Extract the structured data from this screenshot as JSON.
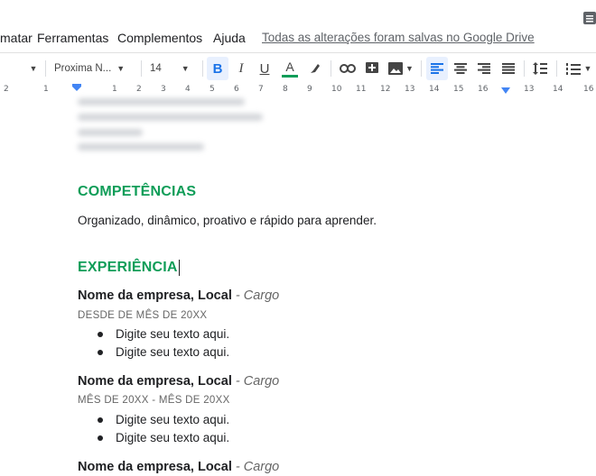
{
  "menu": {
    "items": [
      "matar",
      "Ferramentas",
      "Complementos",
      "Ajuda"
    ],
    "saved_status": "Todas as alterações foram salvas no Google Drive"
  },
  "toolbar": {
    "font_name": "Proxima N...",
    "font_size": "14",
    "text_color_bar": "#0f9d58"
  },
  "ruler": {
    "labels": [
      "2",
      "1",
      "1",
      "2",
      "3",
      "4",
      "5",
      "6",
      "7",
      "8",
      "9",
      "10",
      "11",
      "12",
      "13",
      "14",
      "15",
      "16"
    ]
  },
  "document": {
    "sections": {
      "competencias_title": "COMPETÊNCIAS",
      "competencias_text": "Organizado, dinâmico, proativo e rápido para aprender.",
      "experiencia_title": "EXPERIÊNCIA"
    },
    "jobs": [
      {
        "company": "Nome da empresa,  Local",
        "sep": " - ",
        "role": "Cargo",
        "date": "DESDE DE MÊS DE 20XX",
        "bullets": [
          "Digite seu texto aqui.",
          "Digite seu texto aqui."
        ]
      },
      {
        "company": "Nome da empresa, Local",
        "sep": " - ",
        "role": "Cargo",
        "date": "MÊS DE 20XX - MÊS DE 20XX",
        "bullets": [
          "Digite seu texto aqui.",
          "Digite seu texto aqui."
        ]
      },
      {
        "company": "Nome da empresa, Local",
        "sep": " - ",
        "role": "Cargo"
      }
    ]
  },
  "colors": {
    "heading_green": "#0f9d58",
    "active_blue": "#1a73e8"
  }
}
